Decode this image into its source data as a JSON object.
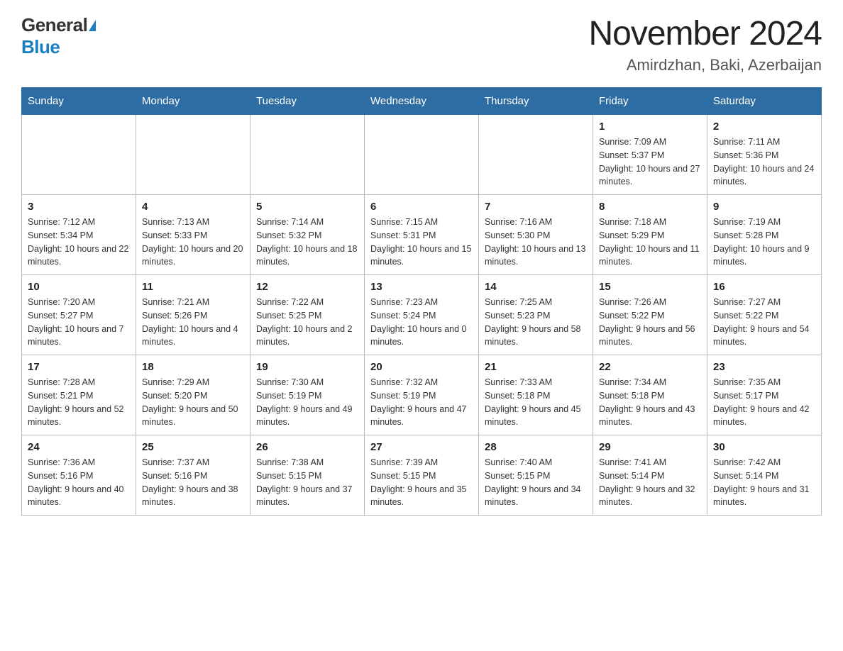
{
  "header": {
    "logo_general": "General",
    "logo_blue": "Blue",
    "title": "November 2024",
    "subtitle": "Amirdzhan, Baki, Azerbaijan"
  },
  "days_of_week": [
    "Sunday",
    "Monday",
    "Tuesday",
    "Wednesday",
    "Thursday",
    "Friday",
    "Saturday"
  ],
  "weeks": [
    {
      "days": [
        {
          "number": "",
          "info": "",
          "empty": true
        },
        {
          "number": "",
          "info": "",
          "empty": true
        },
        {
          "number": "",
          "info": "",
          "empty": true
        },
        {
          "number": "",
          "info": "",
          "empty": true
        },
        {
          "number": "",
          "info": "",
          "empty": true
        },
        {
          "number": "1",
          "info": "Sunrise: 7:09 AM\nSunset: 5:37 PM\nDaylight: 10 hours and 27 minutes."
        },
        {
          "number": "2",
          "info": "Sunrise: 7:11 AM\nSunset: 5:36 PM\nDaylight: 10 hours and 24 minutes."
        }
      ]
    },
    {
      "days": [
        {
          "number": "3",
          "info": "Sunrise: 7:12 AM\nSunset: 5:34 PM\nDaylight: 10 hours and 22 minutes."
        },
        {
          "number": "4",
          "info": "Sunrise: 7:13 AM\nSunset: 5:33 PM\nDaylight: 10 hours and 20 minutes."
        },
        {
          "number": "5",
          "info": "Sunrise: 7:14 AM\nSunset: 5:32 PM\nDaylight: 10 hours and 18 minutes."
        },
        {
          "number": "6",
          "info": "Sunrise: 7:15 AM\nSunset: 5:31 PM\nDaylight: 10 hours and 15 minutes."
        },
        {
          "number": "7",
          "info": "Sunrise: 7:16 AM\nSunset: 5:30 PM\nDaylight: 10 hours and 13 minutes."
        },
        {
          "number": "8",
          "info": "Sunrise: 7:18 AM\nSunset: 5:29 PM\nDaylight: 10 hours and 11 minutes."
        },
        {
          "number": "9",
          "info": "Sunrise: 7:19 AM\nSunset: 5:28 PM\nDaylight: 10 hours and 9 minutes."
        }
      ]
    },
    {
      "days": [
        {
          "number": "10",
          "info": "Sunrise: 7:20 AM\nSunset: 5:27 PM\nDaylight: 10 hours and 7 minutes."
        },
        {
          "number": "11",
          "info": "Sunrise: 7:21 AM\nSunset: 5:26 PM\nDaylight: 10 hours and 4 minutes."
        },
        {
          "number": "12",
          "info": "Sunrise: 7:22 AM\nSunset: 5:25 PM\nDaylight: 10 hours and 2 minutes."
        },
        {
          "number": "13",
          "info": "Sunrise: 7:23 AM\nSunset: 5:24 PM\nDaylight: 10 hours and 0 minutes."
        },
        {
          "number": "14",
          "info": "Sunrise: 7:25 AM\nSunset: 5:23 PM\nDaylight: 9 hours and 58 minutes."
        },
        {
          "number": "15",
          "info": "Sunrise: 7:26 AM\nSunset: 5:22 PM\nDaylight: 9 hours and 56 minutes."
        },
        {
          "number": "16",
          "info": "Sunrise: 7:27 AM\nSunset: 5:22 PM\nDaylight: 9 hours and 54 minutes."
        }
      ]
    },
    {
      "days": [
        {
          "number": "17",
          "info": "Sunrise: 7:28 AM\nSunset: 5:21 PM\nDaylight: 9 hours and 52 minutes."
        },
        {
          "number": "18",
          "info": "Sunrise: 7:29 AM\nSunset: 5:20 PM\nDaylight: 9 hours and 50 minutes."
        },
        {
          "number": "19",
          "info": "Sunrise: 7:30 AM\nSunset: 5:19 PM\nDaylight: 9 hours and 49 minutes."
        },
        {
          "number": "20",
          "info": "Sunrise: 7:32 AM\nSunset: 5:19 PM\nDaylight: 9 hours and 47 minutes."
        },
        {
          "number": "21",
          "info": "Sunrise: 7:33 AM\nSunset: 5:18 PM\nDaylight: 9 hours and 45 minutes."
        },
        {
          "number": "22",
          "info": "Sunrise: 7:34 AM\nSunset: 5:18 PM\nDaylight: 9 hours and 43 minutes."
        },
        {
          "number": "23",
          "info": "Sunrise: 7:35 AM\nSunset: 5:17 PM\nDaylight: 9 hours and 42 minutes."
        }
      ]
    },
    {
      "days": [
        {
          "number": "24",
          "info": "Sunrise: 7:36 AM\nSunset: 5:16 PM\nDaylight: 9 hours and 40 minutes."
        },
        {
          "number": "25",
          "info": "Sunrise: 7:37 AM\nSunset: 5:16 PM\nDaylight: 9 hours and 38 minutes."
        },
        {
          "number": "26",
          "info": "Sunrise: 7:38 AM\nSunset: 5:15 PM\nDaylight: 9 hours and 37 minutes."
        },
        {
          "number": "27",
          "info": "Sunrise: 7:39 AM\nSunset: 5:15 PM\nDaylight: 9 hours and 35 minutes."
        },
        {
          "number": "28",
          "info": "Sunrise: 7:40 AM\nSunset: 5:15 PM\nDaylight: 9 hours and 34 minutes."
        },
        {
          "number": "29",
          "info": "Sunrise: 7:41 AM\nSunset: 5:14 PM\nDaylight: 9 hours and 32 minutes."
        },
        {
          "number": "30",
          "info": "Sunrise: 7:42 AM\nSunset: 5:14 PM\nDaylight: 9 hours and 31 minutes."
        }
      ]
    }
  ]
}
